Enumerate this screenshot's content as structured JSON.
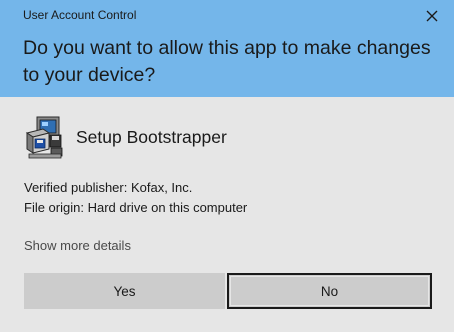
{
  "window": {
    "title": "User Account Control"
  },
  "header": {
    "question": "Do you want to allow this app to make changes to your device?",
    "background_color": "#74b6ea"
  },
  "app": {
    "name": "Setup Bootstrapper",
    "icon": "setup-computer-icon"
  },
  "details": {
    "publisher": "Verified publisher: Kofax, Inc.",
    "origin": "File origin: Hard drive on this computer",
    "show_more_label": "Show more details"
  },
  "buttons": {
    "yes_label": "Yes",
    "no_label": "No"
  },
  "colors": {
    "body_background": "#e6e6e6",
    "button_background": "#cccccc",
    "focused_border": "#1a1a1a"
  }
}
